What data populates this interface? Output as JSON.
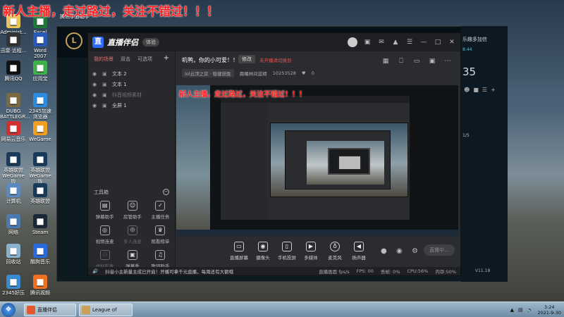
{
  "overlay_banner": "新人主播，走过路过，关注不错过！！！",
  "desktop": {
    "icons": [
      {
        "label": "Administ...",
        "icon": "user-folder-icon",
        "color": "#e8c45a"
      },
      {
        "label": "Excel 2007",
        "icon": "excel-icon",
        "color": "#1d7a3a"
      },
      {
        "label": "腾讯手游助手",
        "icon": "tencent-gamebox-icon",
        "color": "#2a7be0"
      },
      {
        "label": "迅雷·远程...",
        "icon": "xunlei-icon",
        "color": "#333"
      },
      {
        "label": "Word 2007",
        "icon": "word-icon",
        "color": "#2a5ab8"
      },
      {
        "label": "腾讯QQ",
        "icon": "qq-icon",
        "color": "#111"
      },
      {
        "label": "应用宝",
        "icon": "app-store-icon",
        "color": "#3fb04a"
      },
      {
        "label": "DUBG BATTLEGR...",
        "icon": "pubg-icon",
        "color": "#7a6a40"
      },
      {
        "label": "2345加速浏览器",
        "icon": "browser-icon",
        "color": "#2a8be0"
      },
      {
        "label": "网易云音乐",
        "icon": "netease-music-icon",
        "color": "#d03030"
      },
      {
        "label": "WeGame",
        "icon": "wegame-icon",
        "color": "#f0a020"
      },
      {
        "label": "英雄联盟 WeGame版",
        "icon": "lol-icon",
        "color": "#1a3a5a"
      },
      {
        "label": "英雄联盟 WeGame版",
        "icon": "lol-icon",
        "color": "#1a3a5a"
      },
      {
        "label": "计算机",
        "icon": "computer-icon",
        "color": "#5a8ac0"
      },
      {
        "label": "英雄联盟",
        "icon": "lol-icon",
        "color": "#1a3a5a"
      },
      {
        "label": "网络",
        "icon": "network-icon",
        "color": "#4a7ab0"
      },
      {
        "label": "Steam",
        "icon": "steam-icon",
        "color": "#1b2838"
      },
      {
        "label": "回收站",
        "icon": "recycle-bin-icon",
        "color": "#8ab0d0"
      },
      {
        "label": "酷狗音乐",
        "icon": "kugou-icon",
        "color": "#2a6ae0"
      },
      {
        "label": "2345好压",
        "icon": "zip-icon",
        "color": "#3a8ad0"
      },
      {
        "label": "腾讯视频",
        "icon": "tencent-video-icon",
        "color": "#f07020"
      }
    ]
  },
  "lol_right": {
    "line1": "乐趣多加信",
    "line2": "8:44",
    "number": "35",
    "line3": "1/5",
    "version": "V11.18"
  },
  "streamer": {
    "app_name": "直播伴侣",
    "badge": "体验",
    "left_tabs": [
      "我的场景",
      "双击",
      "可选项"
    ],
    "sources": [
      {
        "name": "文本 2",
        "dim": false
      },
      {
        "name": "文本 1",
        "dim": false
      },
      {
        "name": "抖音视频素材",
        "dim": true
      },
      {
        "name": "全屏 1",
        "dim": false
      }
    ],
    "tools_label": "工具箱",
    "tools": [
      {
        "label": "弹幕助手",
        "icon": "danmaku-icon",
        "dim": false
      },
      {
        "label": "房管助手",
        "icon": "admin-icon",
        "dim": false
      },
      {
        "label": "主播任务",
        "icon": "task-icon",
        "dim": false
      },
      {
        "label": "视频连麦",
        "icon": "video-link-icon",
        "dim": false
      },
      {
        "label": "多人连麦",
        "icon": "multi-link-icon",
        "dim": true
      },
      {
        "label": "观看榜单",
        "icon": "ranking-icon",
        "dim": false
      },
      {
        "label": "虚拟形象",
        "icon": "avatar-icon",
        "dim": true
      },
      {
        "label": "弹幕秀",
        "icon": "danmaku-show-icon",
        "dim": false
      },
      {
        "label": "歌词助手",
        "icon": "lyrics-icon",
        "dim": false
      },
      {
        "label": "点歌台",
        "icon": "song-request-icon",
        "dim": true
      },
      {
        "label": "更多",
        "icon": "more-icon",
        "dim": true
      },
      {
        "label": "互动",
        "icon": "interact-icon",
        "dim": true
      }
    ],
    "preview_title": "叽鸭，你的小可爱！！！",
    "edit_label": "修改",
    "preview_note": "未开播请切换到",
    "chip1": "lol云顶之弈 · 稳健获胜",
    "chip2": "晨曦林间蓝精",
    "room_id": "10253528",
    "likes": "0",
    "controls": [
      {
        "label": "直播屏幕",
        "icon": "screen-icon"
      },
      {
        "label": "摄像头",
        "icon": "camera-icon"
      },
      {
        "label": "手机投屏",
        "icon": "phone-cast-icon"
      },
      {
        "label": "多媒体",
        "icon": "media-icon"
      },
      {
        "label": "麦克风",
        "icon": "mic-icon"
      },
      {
        "label": "扬声器",
        "icon": "speaker-icon"
      }
    ],
    "start_label": "直播中...",
    "status_msg": "抖音小主新量主成已开启！开播可拿千元直播，每周还有大额哦",
    "status_fps": "直播画面 fps/s",
    "status_fps2": "FPS: 00",
    "status_drop": "丢帧: 0%",
    "status_cpu": "CPU:56%",
    "status_mem": "内存:50%"
  },
  "taskbar": {
    "items": [
      {
        "label": "直播伴侣",
        "color": "#e25a2a"
      },
      {
        "label": "League of Lege...",
        "color": "#c9a15a"
      }
    ],
    "time": "3:24",
    "date": "2021-9-30"
  }
}
